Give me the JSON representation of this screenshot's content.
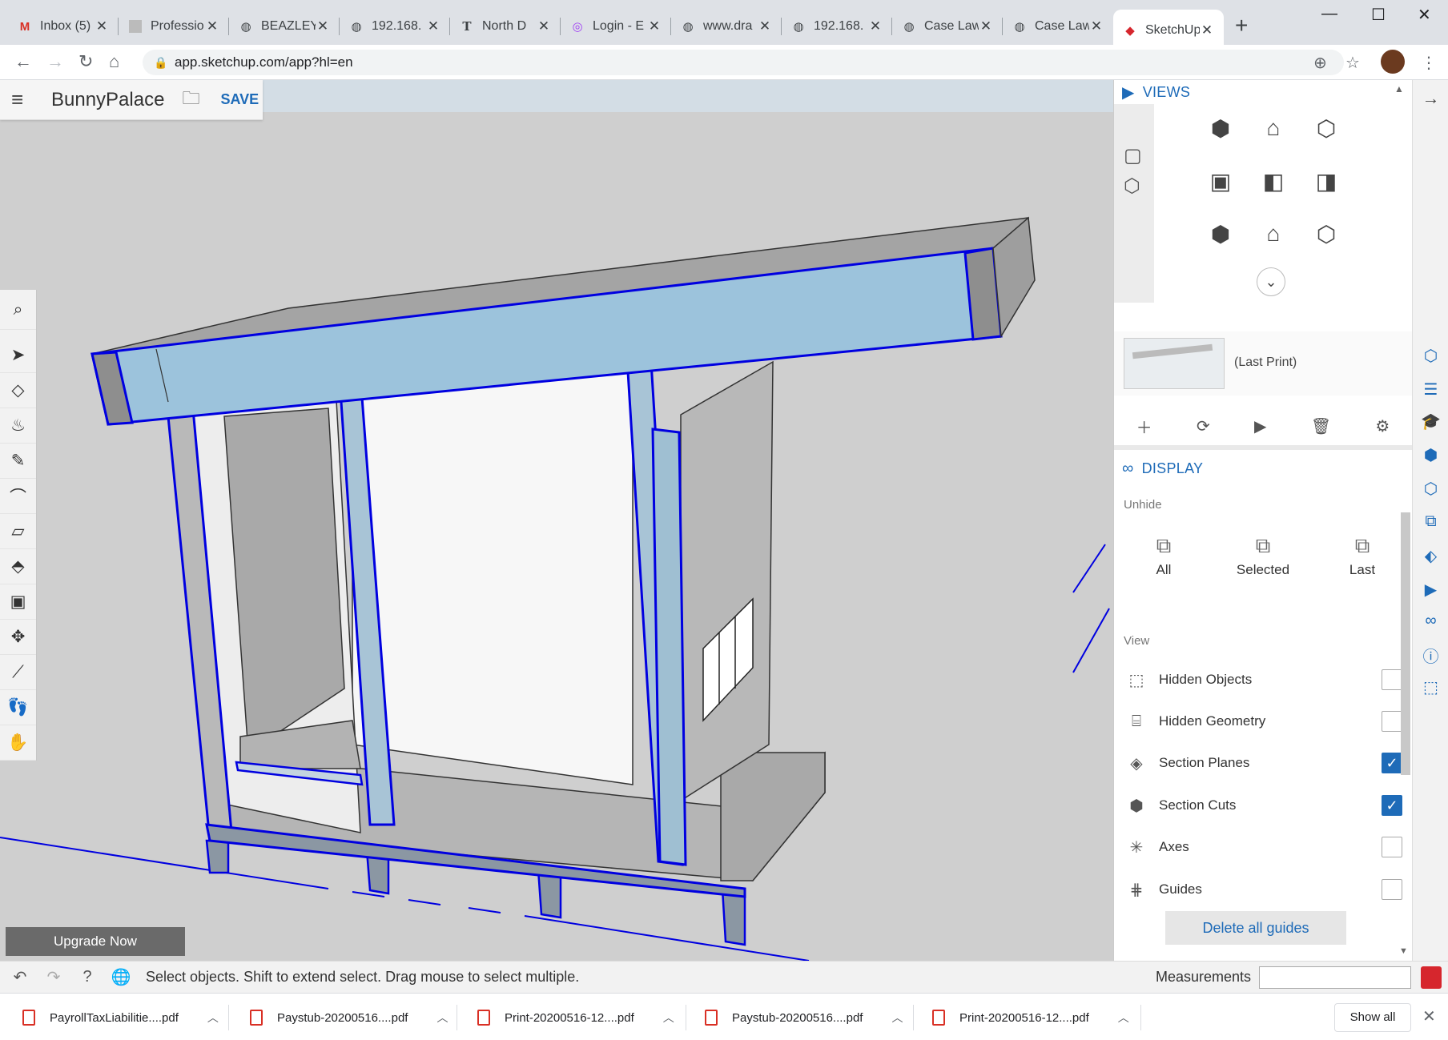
{
  "browser": {
    "tabs": [
      {
        "title": "Inbox (5)",
        "icon": "gmail-icon"
      },
      {
        "title": "Professio",
        "icon": "page-icon"
      },
      {
        "title": "BEAZLEY",
        "icon": "globe-icon"
      },
      {
        "title": "192.168.",
        "icon": "globe-icon"
      },
      {
        "title": "North D",
        "icon": "nyt-icon"
      },
      {
        "title": "Login - E",
        "icon": "login-icon"
      },
      {
        "title": "www.dra",
        "icon": "globe-icon"
      },
      {
        "title": "192.168.",
        "icon": "globe-icon"
      },
      {
        "title": "Case Law",
        "icon": "globe-icon"
      },
      {
        "title": "Case Law",
        "icon": "globe-icon"
      },
      {
        "title": "SketchUp",
        "icon": "sketchup-icon"
      }
    ],
    "url": "app.sketchup.com/app?hl=en"
  },
  "app": {
    "document_name": "BunnyPalace",
    "save_label": "SAVE",
    "upgrade_label": "Upgrade Now"
  },
  "panel": {
    "views_title": "VIEWS",
    "scene_label": "(Last Print)",
    "display_title": "DISPLAY",
    "unhide_label": "Unhide",
    "unhide_buttons": [
      {
        "label": "All"
      },
      {
        "label": "Selected"
      },
      {
        "label": "Last"
      }
    ],
    "view_label": "View",
    "view_options": [
      {
        "label": "Hidden Objects",
        "checked": false
      },
      {
        "label": "Hidden Geometry",
        "checked": false
      },
      {
        "label": "Section Planes",
        "checked": true
      },
      {
        "label": "Section Cuts",
        "checked": true
      },
      {
        "label": "Axes",
        "checked": false
      },
      {
        "label": "Guides",
        "checked": false
      }
    ],
    "delete_guides_label": "Delete all guides"
  },
  "status": {
    "hint": "Select objects. Shift to extend select. Drag mouse to select multiple.",
    "measurements_label": "Measurements"
  },
  "downloads": [
    {
      "name": "PayrollTaxLiabilitie....pdf"
    },
    {
      "name": "Paystub-20200516....pdf"
    },
    {
      "name": "Print-20200516-12....pdf"
    },
    {
      "name": "Paystub-20200516....pdf"
    },
    {
      "name": "Print-20200516-12....pdf"
    }
  ],
  "show_all_label": "Show all",
  "colors": {
    "accent": "#1e6bb8",
    "selection": "#0000e0",
    "selected_fill": "#9cc3dc"
  }
}
